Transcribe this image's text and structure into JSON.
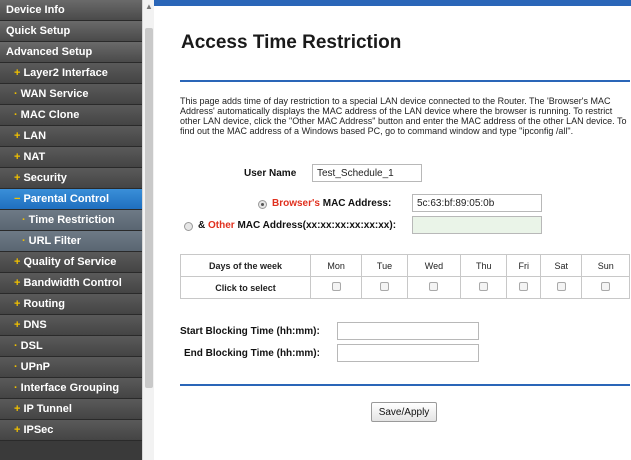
{
  "sidebar": {
    "items": [
      {
        "label": "Device Info",
        "level": "top",
        "bullet": ""
      },
      {
        "label": "Quick Setup",
        "level": "top",
        "bullet": ""
      },
      {
        "label": "Advanced Setup",
        "level": "top",
        "bullet": ""
      },
      {
        "label": "Layer2 Interface",
        "level": "sub",
        "bullet": "+"
      },
      {
        "label": "WAN Service",
        "level": "sub",
        "bullet": "·"
      },
      {
        "label": "MAC Clone",
        "level": "sub",
        "bullet": "·"
      },
      {
        "label": "LAN",
        "level": "sub",
        "bullet": "+"
      },
      {
        "label": "NAT",
        "level": "sub",
        "bullet": "+"
      },
      {
        "label": "Security",
        "level": "sub",
        "bullet": "+"
      },
      {
        "label": "Parental Control",
        "level": "sub",
        "bullet": "−",
        "active": true
      },
      {
        "label": "Time Restriction",
        "level": "subsub",
        "bullet": "·"
      },
      {
        "label": "URL Filter",
        "level": "subsub",
        "bullet": "·"
      },
      {
        "label": "Quality of Service",
        "level": "sub",
        "bullet": "+"
      },
      {
        "label": "Bandwidth Control",
        "level": "sub",
        "bullet": "+"
      },
      {
        "label": "Routing",
        "level": "sub",
        "bullet": "+"
      },
      {
        "label": "DNS",
        "level": "sub",
        "bullet": "+"
      },
      {
        "label": "DSL",
        "level": "sub",
        "bullet": "·"
      },
      {
        "label": "UPnP",
        "level": "sub",
        "bullet": "·"
      },
      {
        "label": "Interface Grouping",
        "level": "sub",
        "bullet": "·"
      },
      {
        "label": "IP Tunnel",
        "level": "sub",
        "bullet": "+"
      },
      {
        "label": "IPSec",
        "level": "sub",
        "bullet": "+"
      }
    ]
  },
  "main": {
    "title": "Access Time Restriction",
    "description": "This page adds time of day restriction to a special LAN device connected to the Router. The 'Browser's MAC Address' automatically displays the MAC address of the LAN device where the browser is running. To restrict other LAN device, click the \"Other MAC Address\" button and enter the MAC address of the other LAN device. To find out the MAC address of a Windows based PC, go to command window and type \"ipconfig /all\".",
    "user_name_label": "User Name",
    "user_name_value": "Test_Schedule_1",
    "browser_mac_label_red": "Browser's",
    "browser_mac_label_rest": " MAC Address:",
    "browser_mac_value": "5c:63:bf:89:05:0b",
    "other_mac_prefix": "& ",
    "other_mac_label_red": "Other",
    "other_mac_label_rest": " MAC Address(xx:xx:xx:xx:xx:xx):",
    "other_mac_value": "",
    "schedule": {
      "row1_label": "Days of the week",
      "row2_label": "Click to select",
      "days": [
        "Mon",
        "Tue",
        "Wed",
        "Thu",
        "Fri",
        "Sat",
        "Sun"
      ]
    },
    "start_label": "Start Blocking Time (hh:mm):",
    "start_value": "",
    "end_label": "End Blocking Time (hh:mm):",
    "end_value": "",
    "save_label": "Save/Apply"
  },
  "colors": {
    "accent_blue": "#2a66b8",
    "active_nav": "#1f6fbf",
    "bullet_yellow": "#f0c000",
    "label_red": "#e0301e"
  }
}
